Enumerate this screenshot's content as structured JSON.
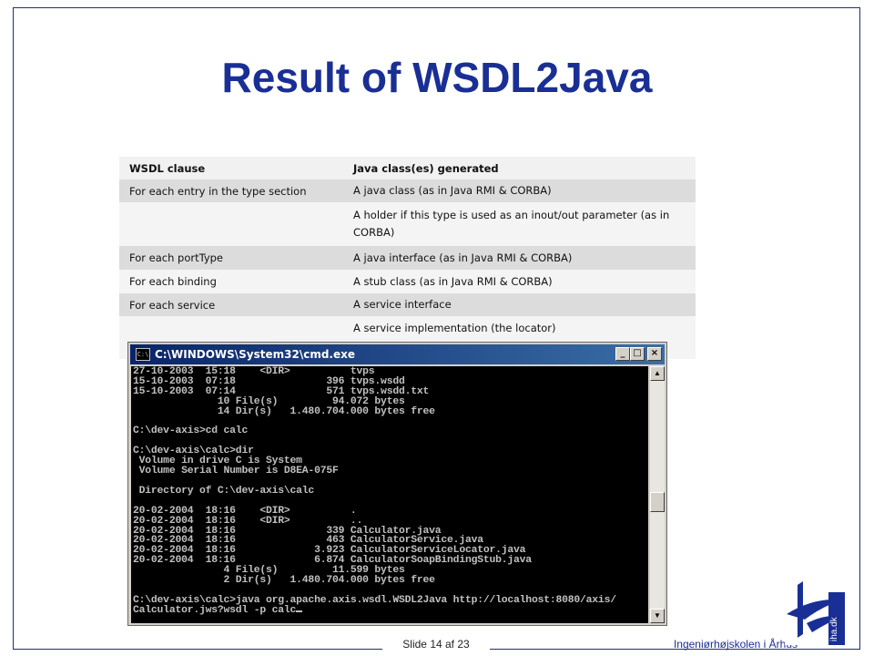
{
  "slide": {
    "title": "Result of WSDL2Java",
    "slide_number": "Slide 14 af  23",
    "school": "Ingeniørhøjskolen i Århus",
    "logo_text": "iha.dk"
  },
  "table": {
    "headers": [
      "WSDL clause",
      "Java class(es) generated"
    ],
    "rows": [
      [
        "For each entry in the type section",
        "A java class (as in Java RMI & CORBA)"
      ],
      [
        "",
        "A holder if this type is used as an inout/out parameter (as in CORBA)"
      ],
      [
        "For each portType",
        "A java interface (as in Java RMI & CORBA)"
      ],
      [
        "For each binding",
        "A stub class (as in Java RMI & CORBA)"
      ],
      [
        "For each service",
        "A service interface"
      ],
      [
        "",
        "A service implementation (the locator)"
      ]
    ]
  },
  "cmd": {
    "title": "C:\\WINDOWS\\System32\\cmd.exe",
    "icon_label": "C:\\",
    "lines": [
      "27-10-2003  15:18    <DIR>          tvps",
      "15-10-2003  07:18               396 tvps.wsdd",
      "15-10-2003  07:14               571 tvps.wsdd.txt",
      "              10 File(s)         94.072 bytes",
      "              14 Dir(s)   1.480.704.000 bytes free",
      "",
      "C:\\dev-axis>cd calc",
      "",
      "C:\\dev-axis\\calc>dir",
      " Volume in drive C is System",
      " Volume Serial Number is D8EA-075F",
      "",
      " Directory of C:\\dev-axis\\calc",
      "",
      "20-02-2004  18:16    <DIR>          .",
      "20-02-2004  18:16    <DIR>          ..",
      "20-02-2004  18:16               339 Calculator.java",
      "20-02-2004  18:16               463 CalculatorService.java",
      "20-02-2004  18:16             3.923 CalculatorServiceLocator.java",
      "20-02-2004  18:16             6.874 CalculatorSoapBindingStub.java",
      "               4 File(s)         11.599 bytes",
      "               2 Dir(s)   1.480.704.000 bytes free",
      "",
      "C:\\dev-axis\\calc>java org.apache.axis.wsdl.WSDL2Java http://localhost:8080/axis/",
      "Calculator.jws?wsdl -p calc"
    ]
  },
  "colors": {
    "title_blue": "#1a2f95",
    "titlebar_start": "#0a246a",
    "titlebar_end": "#3a6ea5",
    "console_text": "#c0c0c0"
  }
}
